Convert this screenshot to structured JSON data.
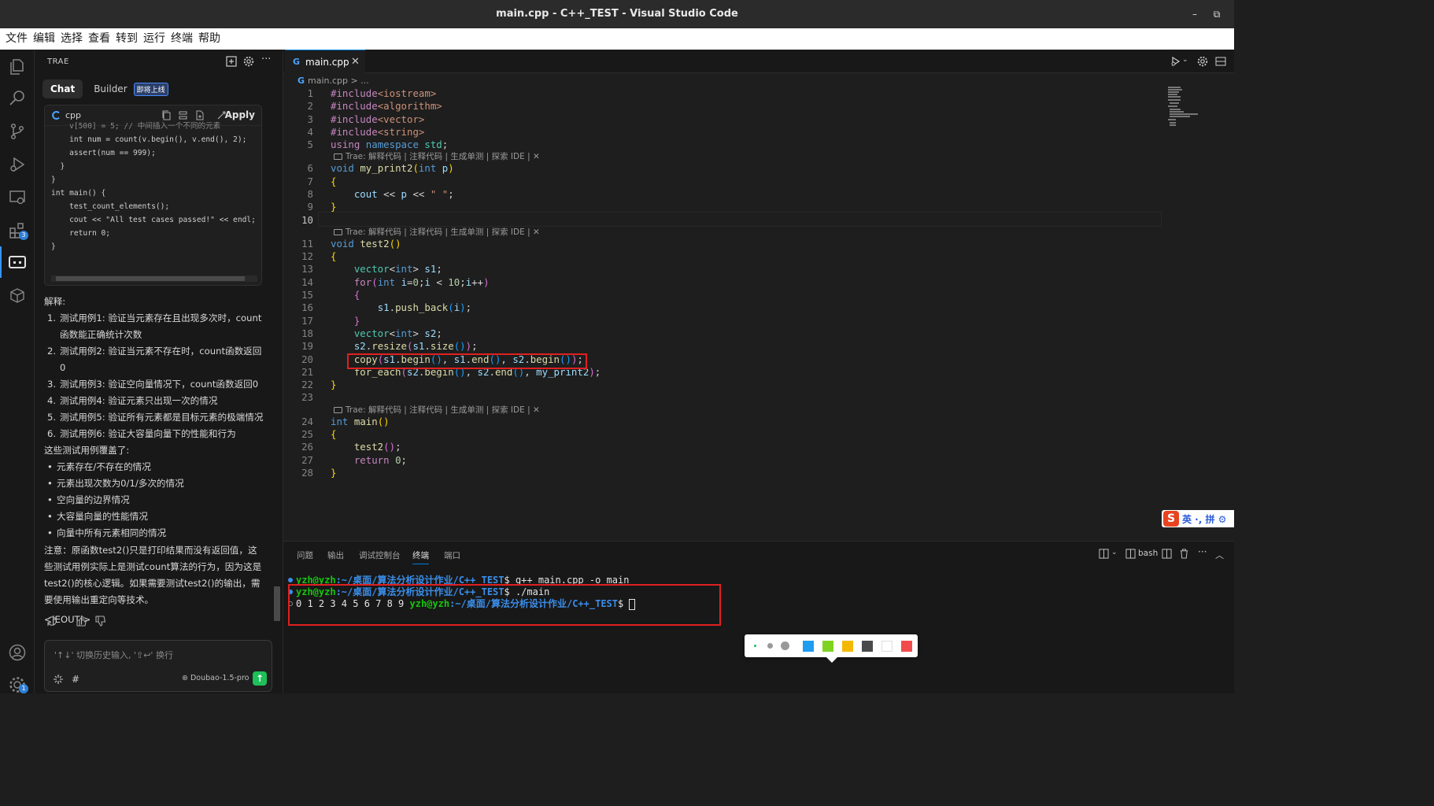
{
  "window": {
    "title": "main.cpp - C++_TEST - Visual Studio Code",
    "minimize": "–",
    "restore": "⧉"
  },
  "menu": [
    "文件",
    "编辑",
    "选择",
    "查看",
    "转到",
    "运行",
    "终端",
    "帮助"
  ],
  "activity": {
    "extensions_badge": "3",
    "settings_badge": "1"
  },
  "side": {
    "header": "TRAE",
    "tabs": {
      "chat": "Chat",
      "builder": "Builder",
      "builder_badge": "即将上线"
    },
    "codecard": {
      "lang": "cpp",
      "apply": "Apply",
      "lines": [
        "    v[500] = 5; // 中间插入一个不同的元素",
        "    int num = count(v.begin(), v.end(), 2);",
        "    assert(num == 999);",
        "  }",
        "}",
        "",
        "int main() {",
        "    test_count_elements();",
        "    cout << \"All test cases passed!\" << endl;",
        "    return 0;",
        "}"
      ]
    },
    "explain": {
      "heading": "解释:",
      "numbered": [
        {
          "n": "1.",
          "text": "测试用例1: 验证当元素存在且出现多次时，count函数能正确统计次数"
        },
        {
          "n": "2.",
          "text": "测试用例2: 验证当元素不存在时，count函数返回0"
        },
        {
          "n": "3.",
          "text": "测试用例3: 验证空向量情况下，count函数返回0"
        },
        {
          "n": "4.",
          "text": "测试用例4: 验证元素只出现一次的情况"
        },
        {
          "n": "5.",
          "text": "测试用例5: 验证所有元素都是目标元素的极端情况"
        },
        {
          "n": "6.",
          "text": "测试用例6: 验证大容量向量下的性能和行为"
        }
      ],
      "cover_heading": "这些测试用例覆盖了:",
      "bullets": [
        "元素存在/不存在的情况",
        "元素出现次数为0/1/多次的情况",
        "空向量的边界情况",
        "大容量向量的性能情况",
        "向量中所有元素相同的情况"
      ],
      "note": "注意：原函数test2()只是打印结果而没有返回值，这些测试用例实际上是测试count算法的行为，因为这是test2()的核心逻辑。如果需要测试test2()的输出，需要使用输出重定向等技术。",
      "eout": "<|EOUT|>"
    },
    "input": {
      "placeholder": "'↑↓' 切换历史输入, '⇧↩' 换行",
      "hash": "#",
      "model": "Doubao-1.5-pro",
      "send": "↑"
    }
  },
  "editor": {
    "tab_label": "main.cpp",
    "tab_close": "✕",
    "tab_icon": "G",
    "breadcrumb": {
      "file": "main.cpp",
      "sep": " > ..."
    },
    "codelens": "Trae: 解释代码 | 注释代码 | 生成单测 | 探索 IDE | ✕",
    "line_numbers": [
      "1",
      "2",
      "3",
      "4",
      "5",
      "6",
      "7",
      "8",
      "9",
      "10",
      "11",
      "12",
      "13",
      "14",
      "15",
      "16",
      "17",
      "18",
      "19",
      "20",
      "21",
      "22",
      "23",
      "24",
      "25",
      "26",
      "27",
      "28"
    ],
    "current_line": "10"
  },
  "ime": {
    "logo": "S",
    "text": "英 ·, 拼 ⚙"
  },
  "panel": {
    "tabs": [
      "问题",
      "输出",
      "调试控制台",
      "终端",
      "端口"
    ],
    "active_tab": "终端",
    "shell": "bash",
    "terminal": [
      {
        "prompt": "yzh@yzh",
        "path": ":~/桌面/算法分析设计作业/C++_TEST",
        "cmd": "$ g++ main.cpp -o main"
      },
      {
        "prompt": "yzh@yzh",
        "path": ":~/桌面/算法分析设计作业/C++_TEST",
        "cmd": "$ ./main"
      },
      {
        "output": "0 1 2 3 4 5 6 7 8 9 ",
        "prompt": "yzh@yzh",
        "path": ":~/桌面/算法分析设计作业/C++_TEST",
        "cmd": "$ "
      }
    ]
  },
  "palette": {
    "colors": [
      "#1e9cf0",
      "#7ed321",
      "#f5b800",
      "#4a4a4a",
      "#ffffff",
      "#f24b4b"
    ]
  }
}
